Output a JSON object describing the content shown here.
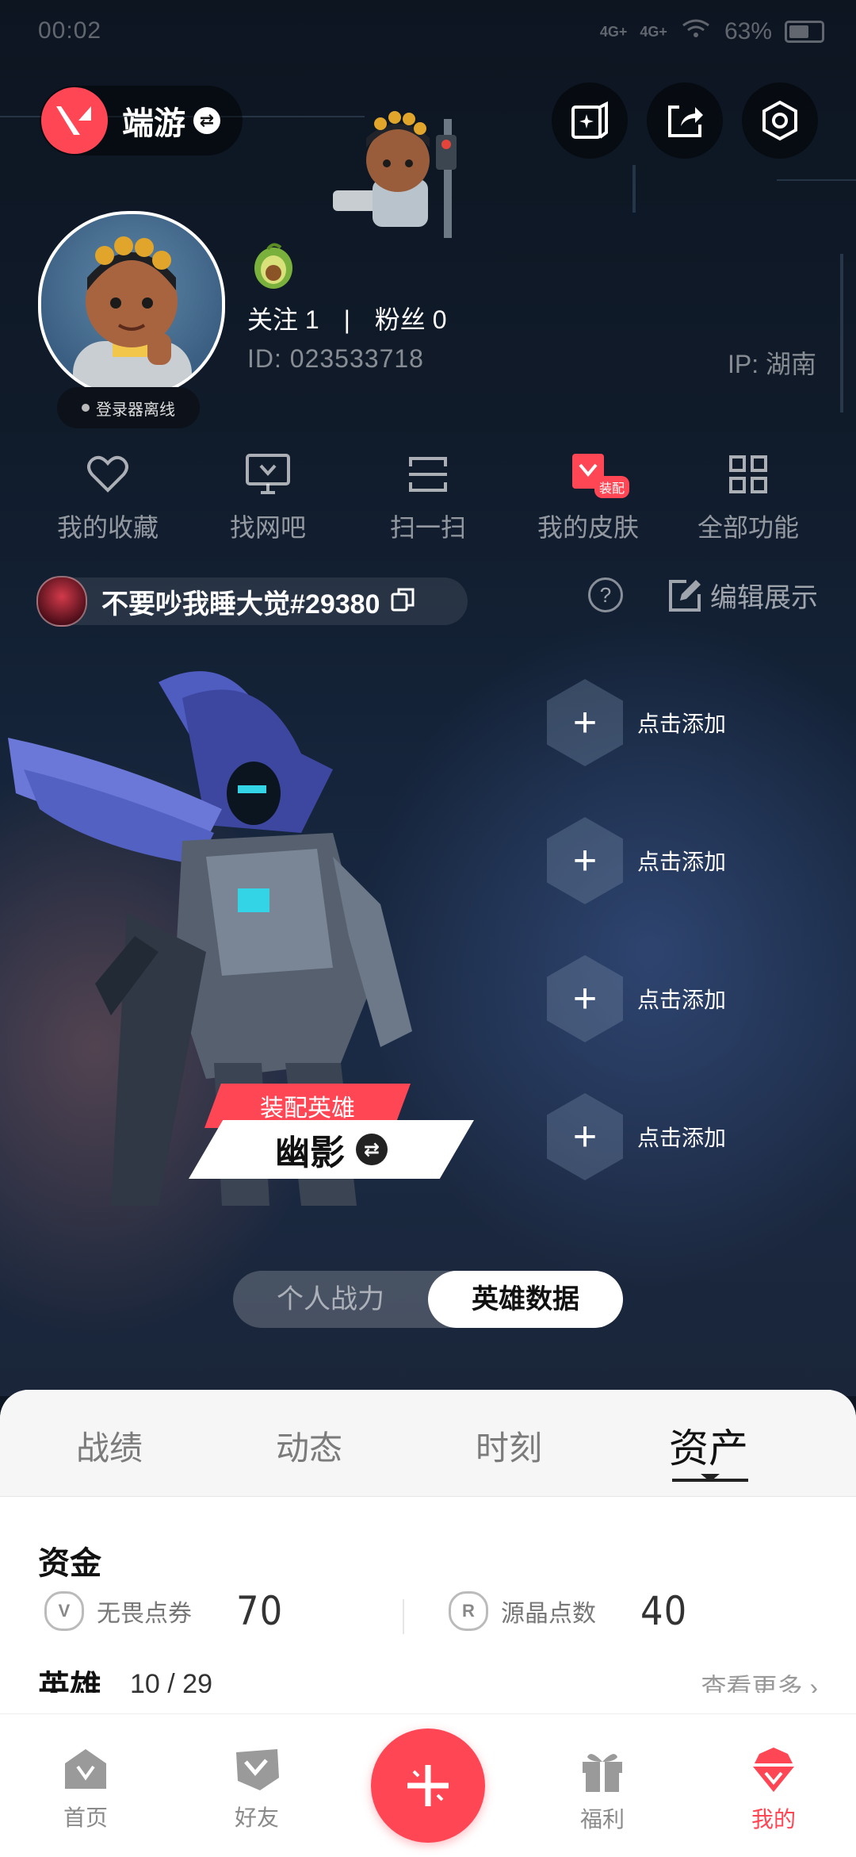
{
  "status_bar": {
    "time": "00:02",
    "signal1": "4G+",
    "signal2": "4G+",
    "battery": "63%"
  },
  "game_switch": {
    "label": "端游",
    "icon": "swap-icon"
  },
  "top_actions": [
    "spark-card-icon",
    "share-icon",
    "settings-icon"
  ],
  "profile": {
    "status": "登录器离线",
    "follow_label": "关注",
    "follow_count": "1",
    "separator": "|",
    "fans_label": "粉丝",
    "fans_count": "0",
    "id_text": "ID: 023533718",
    "ip_text": "IP: 湖南"
  },
  "quick_functions": [
    {
      "label": "我的收藏",
      "icon": "heart-icon"
    },
    {
      "label": "找网吧",
      "icon": "monitor-icon"
    },
    {
      "label": "扫一扫",
      "icon": "scan-icon"
    },
    {
      "label": "我的皮肤",
      "icon": "skin-icon",
      "badge": "装配"
    },
    {
      "label": "全部功能",
      "icon": "grid-icon"
    }
  ],
  "player": {
    "name": "不要吵我睡大觉#29380",
    "edit_label": "编辑展示"
  },
  "showcase": {
    "slot_label": "点击添加",
    "slot_count": 4,
    "equip_tag": "装配英雄",
    "agent_name": "幽影"
  },
  "segment": {
    "left": "个人战力",
    "right": "英雄数据",
    "active": "英雄数据"
  },
  "tabs": [
    "战绩",
    "动态",
    "时刻",
    "资产"
  ],
  "active_tab": "资产",
  "funds": {
    "title": "资金",
    "items": [
      {
        "label": "无畏点券",
        "value": "70",
        "icon": "vp-icon"
      },
      {
        "label": "源晶点数",
        "value": "40",
        "icon": "radianite-icon"
      }
    ]
  },
  "heroes": {
    "title": "英雄",
    "count": "10 / 29",
    "see_more": "查看更多 ›"
  },
  "bottom_nav": [
    {
      "label": "首页",
      "icon": "home-icon"
    },
    {
      "label": "好友",
      "icon": "friends-icon"
    },
    {
      "label": "",
      "icon": "plus-icon"
    },
    {
      "label": "福利",
      "icon": "gift-icon"
    },
    {
      "label": "我的",
      "icon": "profile-icon",
      "active": true
    }
  ],
  "colors": {
    "accent": "#ff4655",
    "background": "#0d1622"
  }
}
